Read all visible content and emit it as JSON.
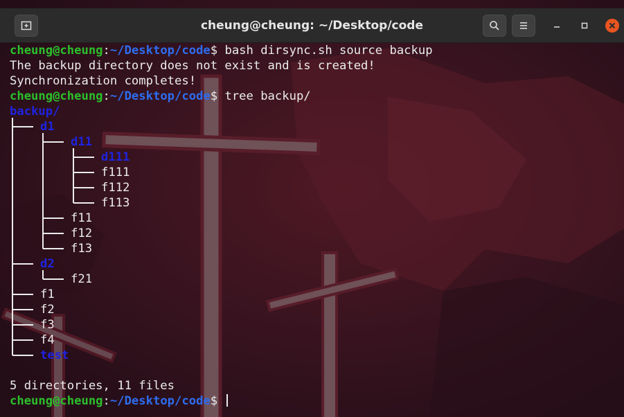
{
  "window": {
    "title": "cheung@cheung: ~/Desktop/code",
    "icons": {
      "new_tab": "new-tab-icon",
      "search": "search-icon",
      "menu": "hamburger-menu-icon",
      "minimize": "minimize-icon",
      "maximize": "maximize-icon",
      "close": "close-icon"
    },
    "colors": {
      "close_button": "#e95420",
      "titlebar": "#2b2b2b"
    }
  },
  "terminal": {
    "colors": {
      "user": "#2bc02b",
      "path": "#2e6df0",
      "directory": "#1f23e0",
      "text": "#ececec"
    },
    "lines": [
      {
        "type": "prompt",
        "user": "cheung@cheung",
        "sep": ":",
        "path": "~/Desktop/code",
        "sigil": "$ ",
        "cmd": "bash dirsync.sh source backup"
      },
      {
        "type": "text",
        "text": "The backup directory does not exist and is created!"
      },
      {
        "type": "text",
        "text": "Synchronization completes!"
      },
      {
        "type": "prompt",
        "user": "cheung@cheung",
        "sep": ":",
        "path": "~/Desktop/code",
        "sigil": "$ ",
        "cmd": "tree backup/"
      },
      {
        "type": "tree",
        "name": "backup/",
        "dir": true,
        "depth": 0
      },
      {
        "type": "tree",
        "name": "d1",
        "dir": true,
        "depth": 1
      },
      {
        "type": "tree",
        "name": "d11",
        "dir": true,
        "depth": 2
      },
      {
        "type": "tree",
        "name": "d111",
        "dir": true,
        "depth": 3
      },
      {
        "type": "tree",
        "name": "f111",
        "dir": false,
        "depth": 3
      },
      {
        "type": "tree",
        "name": "f112",
        "dir": false,
        "depth": 3
      },
      {
        "type": "tree",
        "name": "f113",
        "dir": false,
        "depth": 3
      },
      {
        "type": "tree",
        "name": "f11",
        "dir": false,
        "depth": 2
      },
      {
        "type": "tree",
        "name": "f12",
        "dir": false,
        "depth": 2
      },
      {
        "type": "tree",
        "name": "f13",
        "dir": false,
        "depth": 2
      },
      {
        "type": "tree",
        "name": "d2",
        "dir": true,
        "depth": 1
      },
      {
        "type": "tree",
        "name": "f21",
        "dir": false,
        "depth": 2
      },
      {
        "type": "tree",
        "name": "f1",
        "dir": false,
        "depth": 1
      },
      {
        "type": "tree",
        "name": "f2",
        "dir": false,
        "depth": 1
      },
      {
        "type": "tree",
        "name": "f3",
        "dir": false,
        "depth": 1
      },
      {
        "type": "tree",
        "name": "f4",
        "dir": false,
        "depth": 1
      },
      {
        "type": "tree",
        "name": "test",
        "dir": true,
        "depth": 1
      },
      {
        "type": "text",
        "text": ""
      },
      {
        "type": "text",
        "text": "5 directories, 11 files"
      },
      {
        "type": "prompt",
        "user": "cheung@cheung",
        "sep": ":",
        "path": "~/Desktop/code",
        "sigil": "$ ",
        "cmd": "",
        "cursor": true
      }
    ]
  }
}
